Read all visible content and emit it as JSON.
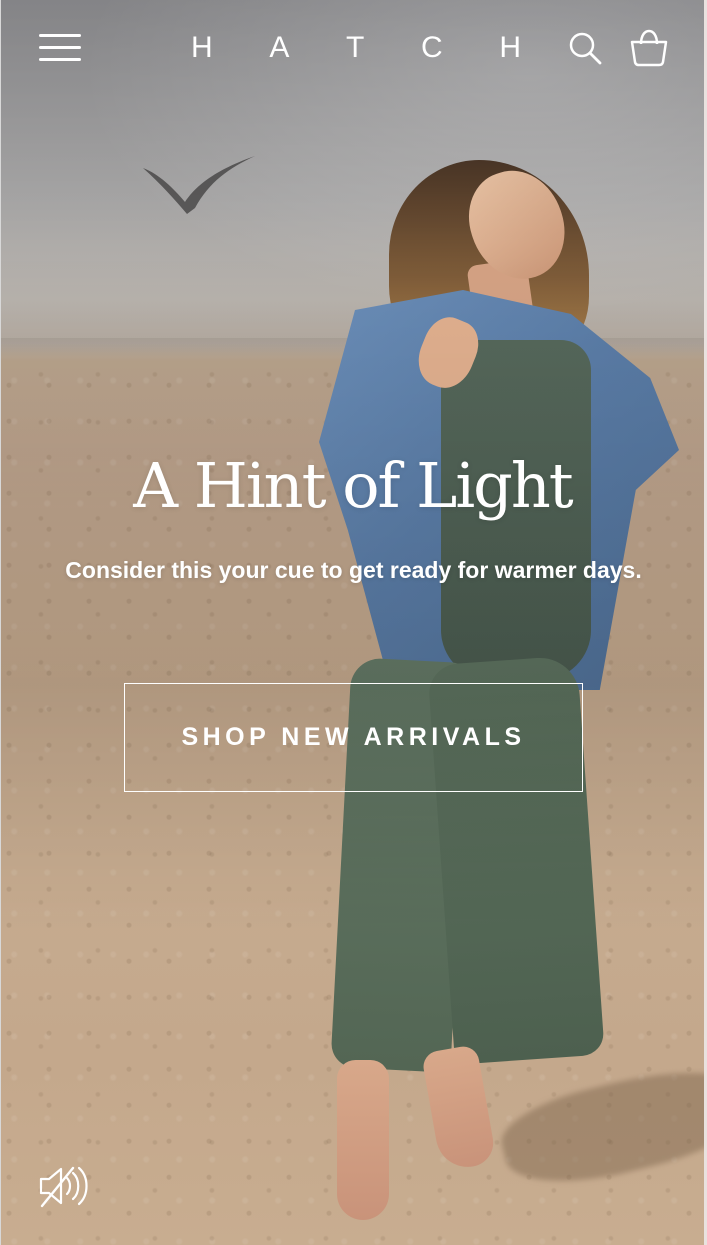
{
  "header": {
    "logo_text": "HATCH",
    "logo_letters": [
      "H",
      "A",
      "T",
      "C",
      "H"
    ],
    "menu_icon": "hamburger-menu-icon",
    "search_icon": "search-icon",
    "cart_icon": "shopping-bag-icon"
  },
  "hero": {
    "headline": "A Hint of Light",
    "subheadline": "Consider this your cue to get ready for warmer days.",
    "cta_label": "SHOP NEW ARRIVALS",
    "mute_icon": "sound-muted-icon"
  },
  "colors": {
    "overlay_text": "#ffffff",
    "sky": "#a7a6a6",
    "sand": "#c4a88c"
  }
}
